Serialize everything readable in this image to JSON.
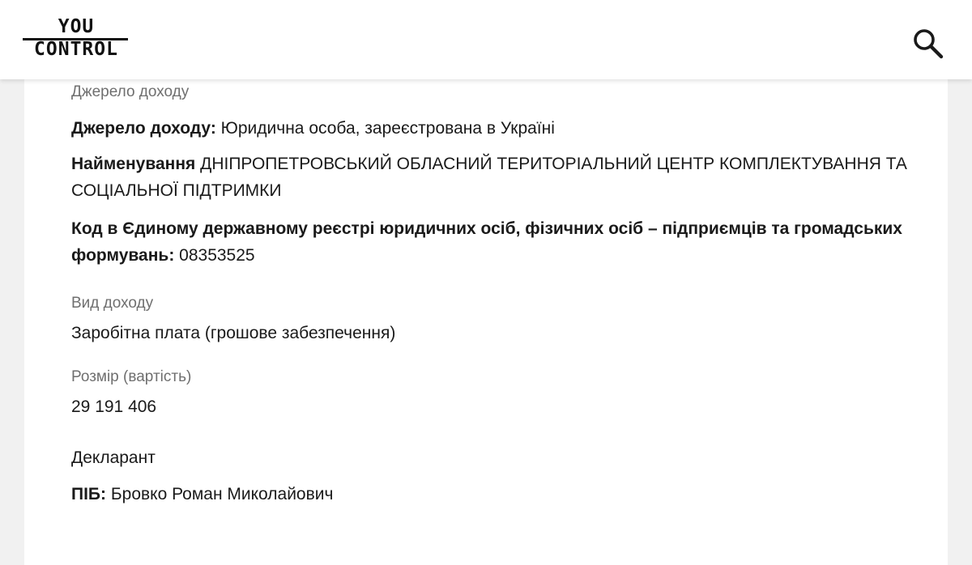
{
  "header": {
    "logo_top": "YOU",
    "logo_bottom": "CONTROL",
    "search_icon": "search-icon"
  },
  "income_source": {
    "section_label": "Джерело доходу",
    "source_label": "Джерело доходу:",
    "source_value": "Юридична особа, зареєстрована в Україні",
    "name_label": "Найменування",
    "name_value": "ДНІПРОПЕТРОВСЬКИЙ ОБЛАСНИЙ ТЕРИТОРІАЛЬНИЙ ЦЕНТР КОМПЛЕКТУВАННЯ ТА СОЦІАЛЬНОЇ ПІДТРИМКИ",
    "code_label": "Код в Єдиному державному реєстрі юридичних осіб, фізичних осіб – підприємців та громадських формувань:",
    "code_value": "08353525"
  },
  "income_type": {
    "label": "Вид доходу",
    "value": "Заробітна плата (грошове забезпечення)"
  },
  "income_amount": {
    "label": "Розмір (вартість)",
    "value": "29 191 406"
  },
  "declarant": {
    "title": "Декларант",
    "name_label": "ПІБ:",
    "name_value": "Бровко Роман Миколайович"
  }
}
